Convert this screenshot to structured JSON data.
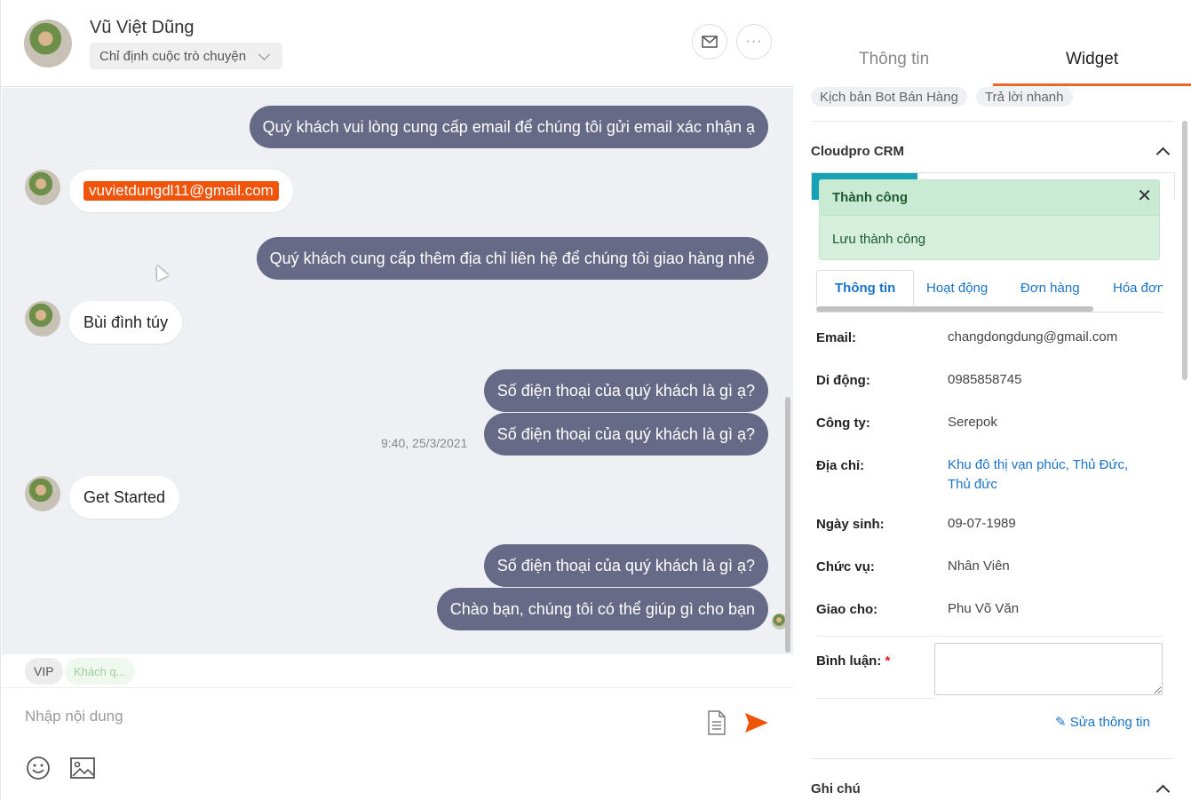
{
  "header": {
    "contact_name": "Vũ Việt Dũng",
    "assign_label": "Chỉ định cuộc trò chuyện",
    "email_icon": "mail-icon",
    "more_icon": "more-icon"
  },
  "messages": {
    "out_1": "Quý khách vui lòng cung cấp email để chúng tôi gửi email xác nhận ạ",
    "in_email": "vuvietdungdl11@gmail.com",
    "out_2": "Quý khách cung cấp thêm địa chỉ liên hệ để chúng tôi giao hàng nhé",
    "in_2": "Bùi đình túy",
    "out_3": "Số điện thoại của quý khách là gì ạ?",
    "out_4": "Số điện thoại của quý khách là gì ạ?",
    "timestamp": "9:40, 25/3/2021",
    "in_3": "Get Started",
    "out_5": "Số điện thoại của quý khách là gì ạ?",
    "out_6": "Chào bạn, chúng tôi có thể giúp gì cho bạn"
  },
  "tags": {
    "vip": "VIP",
    "customer": "Khách q..."
  },
  "composer": {
    "placeholder": "Nhập nội dung",
    "icons": [
      "file-icon",
      "send-icon",
      "emoji-icon",
      "image-icon"
    ],
    "send_color": "#f0540a"
  },
  "side": {
    "tab_info": "Thông tin",
    "tab_widget": "Widget",
    "accent": "#f06522",
    "chips": [
      "Kịch bản Bot Bán Hàng",
      "Trả lời nhanh"
    ],
    "crm_title": "Cloudpro CRM",
    "toast_title": "Thành công",
    "toast_message": "Lưu thành công",
    "inner_tabs": [
      "Thông tin",
      "Hoạt động",
      "Đơn hàng",
      "Hóa đơn"
    ],
    "fields": {
      "email_label": "Email:",
      "email_value": "changdongdung@gmail.com",
      "mobile_label": "Di động:",
      "mobile_value": "0985858745",
      "company_label": "Công ty:",
      "company_value": "Serepok",
      "address_label": "Địa chỉ:",
      "address_value": "Khu đô thị vạn phúc, Thủ Đức, Thủ đức",
      "birthday_label": "Ngày sinh:",
      "birthday_value": "09-07-1989",
      "position_label": "Chức vụ:",
      "position_value": "Nhân Viên",
      "assigned_label": "Giao cho:",
      "assigned_value": "Phu Võ Văn",
      "comment_label": "Bình luận:",
      "required_mark": "*"
    },
    "edit_label": "Sửa thông tin",
    "notes_title": "Ghi chú"
  }
}
